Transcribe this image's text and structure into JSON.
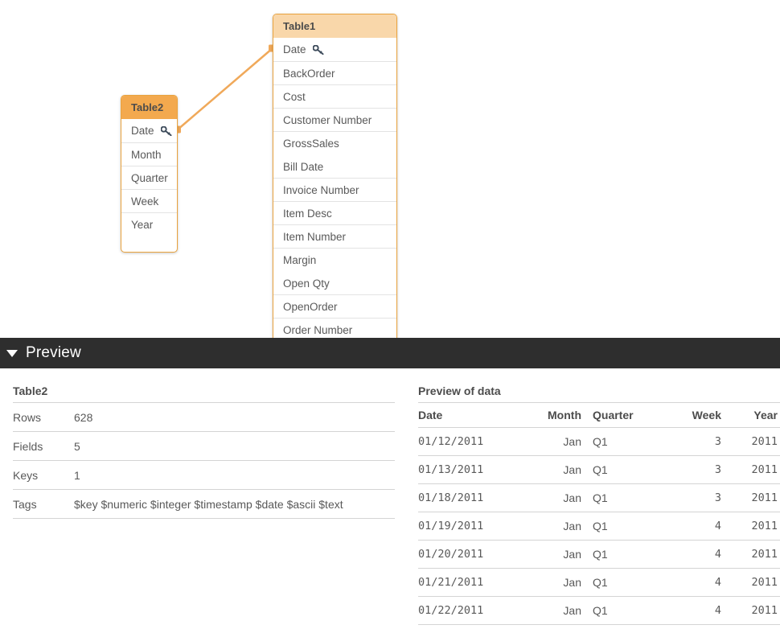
{
  "canvas": {
    "tables": [
      {
        "id": "table1",
        "name": "Table1",
        "header_color": "#f9d7aa",
        "fields": [
          {
            "label": "Date",
            "key": true
          },
          {
            "label": "BackOrder",
            "key": false
          },
          {
            "label": "Cost",
            "key": false
          },
          {
            "label": "Customer Number",
            "key": false
          },
          {
            "label": "GrossSales",
            "key": false
          },
          {
            "label": "Bill Date",
            "key": false
          },
          {
            "label": "Invoice Number",
            "key": false
          },
          {
            "label": "Item Desc",
            "key": false
          },
          {
            "label": "Item Number",
            "key": false
          },
          {
            "label": "Margin",
            "key": false
          },
          {
            "label": "Open Qty",
            "key": false
          },
          {
            "label": "OpenOrder",
            "key": false
          },
          {
            "label": "Order Number",
            "key": false
          }
        ]
      },
      {
        "id": "table2",
        "name": "Table2",
        "header_color": "#f3a94e",
        "fields": [
          {
            "label": "Date",
            "key": true
          },
          {
            "label": "Month",
            "key": false
          },
          {
            "label": "Quarter",
            "key": false
          },
          {
            "label": "Week",
            "key": false
          },
          {
            "label": "Year",
            "key": false
          }
        ]
      }
    ],
    "association": {
      "color": "#f0a95a",
      "from_table": "Table2",
      "from_field": "Date",
      "to_table": "Table1",
      "to_field": "Date"
    },
    "key_icon": "key-icon"
  },
  "preview": {
    "bar_title": "Preview",
    "bar_color": "#2e2e2e",
    "collapse_icon": "triangle-down-icon",
    "meta": {
      "title": "Table2",
      "rows": [
        {
          "label": "Rows",
          "value": "628"
        },
        {
          "label": "Fields",
          "value": "5"
        },
        {
          "label": "Keys",
          "value": "1"
        },
        {
          "label": "Tags",
          "value": "$key $numeric $integer $timestamp $date $ascii $text"
        }
      ]
    },
    "data": {
      "title": "Preview of data",
      "columns": [
        "Date",
        "Month",
        "Quarter",
        "Week",
        "Year"
      ],
      "rows": [
        {
          "Date": "01/12/2011",
          "Month": "Jan",
          "Quarter": "Q1",
          "Week": "3",
          "Year": "2011"
        },
        {
          "Date": "01/13/2011",
          "Month": "Jan",
          "Quarter": "Q1",
          "Week": "3",
          "Year": "2011"
        },
        {
          "Date": "01/18/2011",
          "Month": "Jan",
          "Quarter": "Q1",
          "Week": "3",
          "Year": "2011"
        },
        {
          "Date": "01/19/2011",
          "Month": "Jan",
          "Quarter": "Q1",
          "Week": "4",
          "Year": "2011"
        },
        {
          "Date": "01/20/2011",
          "Month": "Jan",
          "Quarter": "Q1",
          "Week": "4",
          "Year": "2011"
        },
        {
          "Date": "01/21/2011",
          "Month": "Jan",
          "Quarter": "Q1",
          "Week": "4",
          "Year": "2011"
        },
        {
          "Date": "01/22/2011",
          "Month": "Jan",
          "Quarter": "Q1",
          "Week": "4",
          "Year": "2011"
        }
      ]
    }
  }
}
